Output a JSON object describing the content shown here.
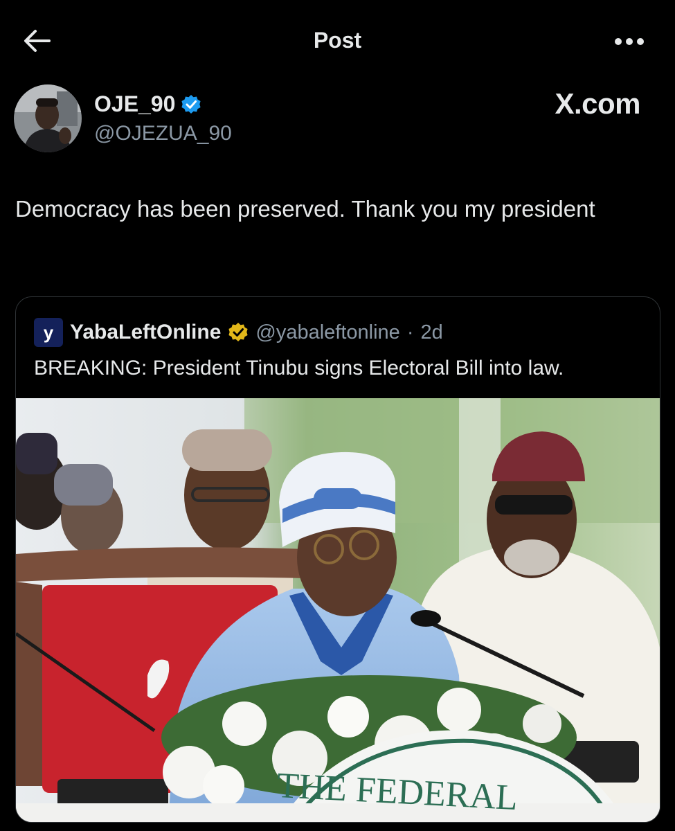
{
  "header": {
    "title": "Post",
    "back_icon": "arrow-left-icon",
    "more_icon": "more-horizontal-icon"
  },
  "author": {
    "display_name": "OJE_90",
    "handle": "@OJEZUA_90",
    "verified_icon": "verified-badge-icon",
    "verified_color": "#1d9bf0"
  },
  "watermark": "X.com",
  "tweet": {
    "text": "Democracy has been preserved. Thank you my president"
  },
  "quoted_post": {
    "logo_letter": "y",
    "display_name": "YabaLeftOnline",
    "handle": "@yabaleftonline",
    "separator": "·",
    "time": "2d",
    "verified_color": "#e2b719",
    "text": "BREAKING: President Tinubu signs Electoral Bill into law.",
    "image_caption_text": "THE FEDERAL"
  }
}
